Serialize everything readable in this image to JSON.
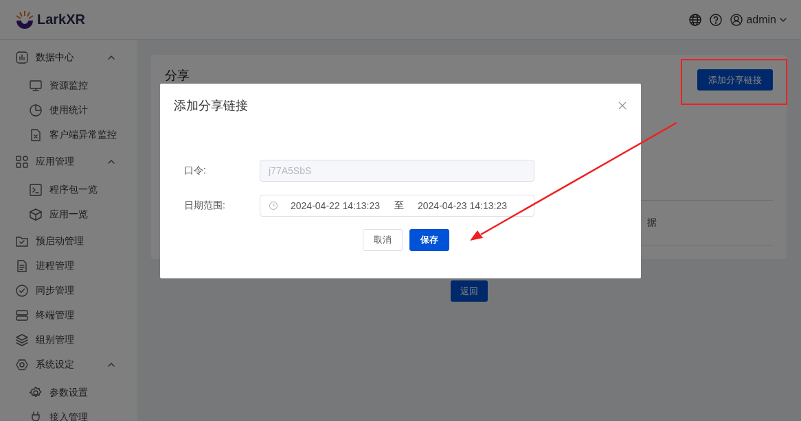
{
  "header": {
    "logo_text": "LarkXR",
    "user": "admin"
  },
  "sidebar": {
    "items": [
      {
        "label": "数据中心",
        "expanded": true,
        "children": [
          {
            "label": "资源监控"
          },
          {
            "label": "使用统计"
          },
          {
            "label": "客户端异常监控"
          }
        ]
      },
      {
        "label": "应用管理",
        "expanded": true,
        "children": [
          {
            "label": "程序包一览"
          },
          {
            "label": "应用一览"
          }
        ]
      },
      {
        "label": "预启动管理"
      },
      {
        "label": "进程管理"
      },
      {
        "label": "同步管理"
      },
      {
        "label": "终端管理"
      },
      {
        "label": "组别管理"
      },
      {
        "label": "系统设定",
        "expanded": true,
        "children": [
          {
            "label": "参数设置"
          },
          {
            "label": "接入管理"
          }
        ]
      }
    ]
  },
  "page": {
    "title": "分享",
    "add_button": "添加分享链接",
    "table_cell": "据",
    "back_button": "返回"
  },
  "dialog": {
    "title": "添加分享链接",
    "fields": [
      {
        "kind": "text",
        "label": "口令:",
        "value": "j77A5SbS",
        "disabled": true
      },
      {
        "kind": "daterange",
        "label": "日期范围:",
        "start": "2024-04-22 14:13:23",
        "separator": "至",
        "end": "2024-04-23 14:13:23"
      }
    ],
    "buttons": [
      {
        "label": "取消",
        "primary": false
      },
      {
        "label": "保存",
        "primary": true
      }
    ]
  }
}
